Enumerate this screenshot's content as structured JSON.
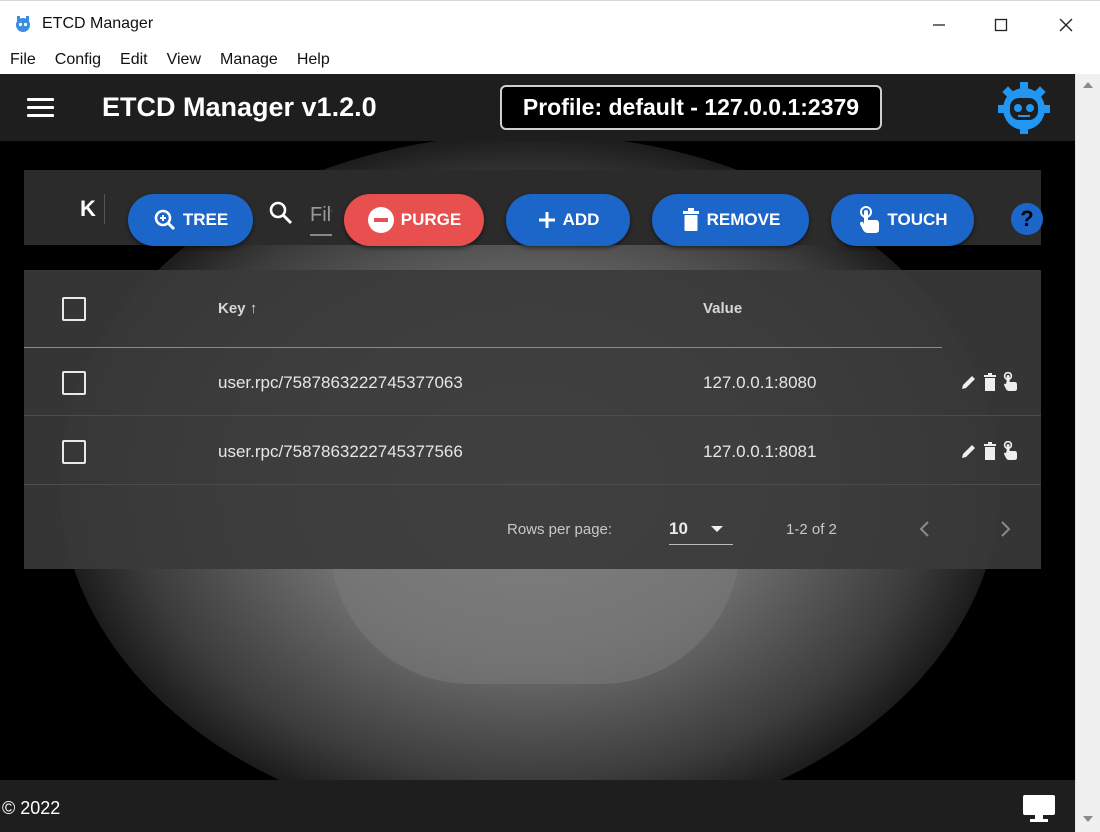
{
  "window": {
    "title": "ETCD Manager",
    "minimize_glyph": "—",
    "maximize_glyph": "☐",
    "close_glyph": "✕"
  },
  "menu": [
    "File",
    "Config",
    "Edit",
    "View",
    "Manage",
    "Help"
  ],
  "header": {
    "title": "ETCD Manager v1.2.0",
    "profile": "Profile: default - 127.0.0.1:2379",
    "logo_icon": "robot-gear-icon"
  },
  "toolbar": {
    "k_label": "K",
    "tree_label": "TREE",
    "filter_placeholder": "Filter",
    "purge_label": "PURGE",
    "add_label": "ADD",
    "remove_label": "REMOVE",
    "touch_label": "TOUCH",
    "help_label": "?"
  },
  "table": {
    "key_header": "Key",
    "value_header": "Value",
    "sort_indicator": "↑",
    "rows": [
      {
        "key": "user.rpc/7587863222745377063",
        "value": "127.0.0.1:8080"
      },
      {
        "key": "user.rpc/7587863222745377566",
        "value": "127.0.0.1:8081"
      }
    ],
    "rows_per_page_label": "Rows per page:",
    "rows_per_page": "10",
    "range": "1-2 of 2"
  },
  "footer": {
    "copyright": "© 2022",
    "monitor_icon": "monitor-icon"
  },
  "colors": {
    "primary_blue": "#1b66c8",
    "danger_red": "#e84f4f",
    "header_bg": "#1e1e1e",
    "accent_logo": "#2196f3"
  }
}
